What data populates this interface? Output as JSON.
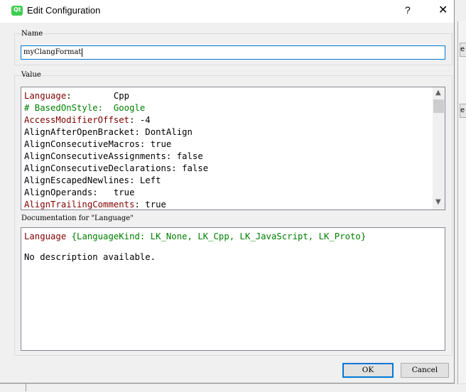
{
  "window": {
    "title": "Edit Configuration",
    "help_symbol": "?",
    "close_symbol": "✕",
    "app_icon": "qt-creator-icon",
    "accent_color": "#0078d7"
  },
  "name_section": {
    "label": "Name",
    "value": "myClangFormat"
  },
  "value_section": {
    "label": "Value",
    "lines": [
      {
        "key": "Language",
        "sep": ":        ",
        "value": "Cpp",
        "comment": false,
        "highlight_key": true
      },
      {
        "key": "# BasedOnStyle:",
        "sep": "  ",
        "value": "Google",
        "comment": true,
        "highlight_key": false
      },
      {
        "key": "AccessModifierOffset",
        "sep": ": ",
        "value": "-4",
        "comment": false,
        "highlight_key": true
      },
      {
        "key": "AlignAfterOpenBracket",
        "sep": ": ",
        "value": "DontAlign",
        "comment": false,
        "highlight_key": false
      },
      {
        "key": "AlignConsecutiveMacros",
        "sep": ": ",
        "value": "true",
        "comment": false,
        "highlight_key": false
      },
      {
        "key": "AlignConsecutiveAssignments",
        "sep": ": ",
        "value": "false",
        "comment": false,
        "highlight_key": false
      },
      {
        "key": "AlignConsecutiveDeclarations",
        "sep": ": ",
        "value": "false",
        "comment": false,
        "highlight_key": false
      },
      {
        "key": "AlignEscapedNewlines",
        "sep": ": ",
        "value": "Left",
        "comment": false,
        "highlight_key": false
      },
      {
        "key": "AlignOperands",
        "sep": ":   ",
        "value": "true",
        "comment": false,
        "highlight_key": false
      },
      {
        "key": "AlignTrailingComments",
        "sep": ": ",
        "value": "true",
        "comment": false,
        "highlight_key": true
      }
    ]
  },
  "documentation": {
    "label": "Documentation for \"Language\"",
    "signature_name": "Language",
    "signature_rest": " {LanguageKind: LK_None, LK_Cpp, LK_JavaScript, LK_Proto}",
    "description": "No description available."
  },
  "buttons": {
    "ok": "OK",
    "cancel": "Cancel"
  }
}
